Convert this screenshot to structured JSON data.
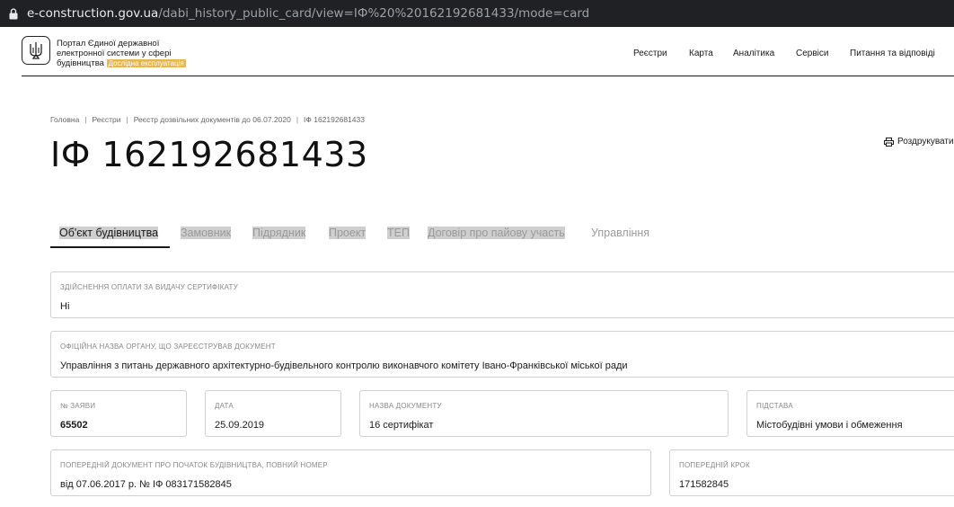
{
  "browser": {
    "url_domain": "e-construction.gov.ua",
    "url_path": "/dabi_history_public_card/view=ІФ%20%20162192681433/mode=card"
  },
  "header": {
    "portal_line1": "Портал Єдиної державної",
    "portal_line2": "електронної системи у сфері",
    "portal_line3": "будівництва",
    "badge": "Дослідна експлуатація",
    "nav": [
      "Реєстри",
      "Карта",
      "Аналітика",
      "Сервіси",
      "Питання та відповіді"
    ]
  },
  "breadcrumb": [
    "Головна",
    "Реєстри",
    "Реєстр дозвільних документів до 06.07.2020",
    "ІФ 162192681433"
  ],
  "page": {
    "title": "ІФ 162192681433",
    "print_label": "Роздрукувати"
  },
  "tabs": [
    "Об'єкт будівництва",
    "Замовник",
    "Підрядник",
    "Проект",
    "ТЕП",
    "Договір про пайову участь",
    "Управління"
  ],
  "fields": {
    "payment": {
      "label": "Здійснення оплати за видачу сертифікату",
      "value": "Ні"
    },
    "authority": {
      "label": "Офіційна назва органу, що зареєстрував документ",
      "value": "Управління з питань державного архітектурно-будівельного контролю виконавчого комітету Івано-Франківської міської ради"
    },
    "app_no": {
      "label": "№ заяви",
      "value": "65502"
    },
    "date": {
      "label": "Дата",
      "value": "25.09.2019"
    },
    "doc_name": {
      "label": "Назва документу",
      "value": "16 сертифікат"
    },
    "basis": {
      "label": "Підстава",
      "value": "Містобудівні умови і обмеження"
    },
    "prev_doc": {
      "label": "Попередній документ про початок будівництва, повний номер",
      "value": "від 07.06.2017 р. № ІФ 083171582845"
    },
    "prev_step": {
      "label": "Попередній крок",
      "value": "171582845"
    }
  },
  "colors": {
    "accent_badge": "#e8b64c",
    "urlbar_bg": "#202124",
    "tab_inactive": "#9a9a9a"
  }
}
